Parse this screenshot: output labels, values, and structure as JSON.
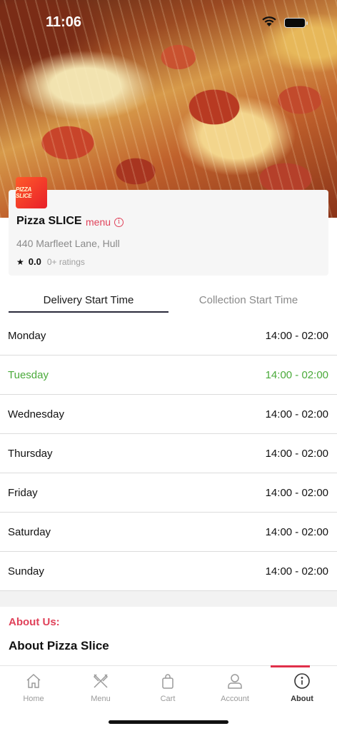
{
  "status_bar": {
    "time": "11:06"
  },
  "restaurant": {
    "logo_text": "PIZZA SLICE",
    "name": "Pizza SLICE",
    "menu_link": "menu",
    "address": "440 Marfleet Lane, Hull",
    "rating": "0.0",
    "ratings_count": "0+ ratings"
  },
  "tabs": [
    {
      "label": "Delivery Start Time",
      "active": true
    },
    {
      "label": "Collection Start Time",
      "active": false
    }
  ],
  "schedule": [
    {
      "day": "Monday",
      "hours": "14:00 - 02:00",
      "today": false
    },
    {
      "day": "Tuesday",
      "hours": "14:00 - 02:00",
      "today": true
    },
    {
      "day": "Wednesday",
      "hours": "14:00 - 02:00",
      "today": false
    },
    {
      "day": "Thursday",
      "hours": "14:00 - 02:00",
      "today": false
    },
    {
      "day": "Friday",
      "hours": "14:00 - 02:00",
      "today": false
    },
    {
      "day": "Saturday",
      "hours": "14:00 - 02:00",
      "today": false
    },
    {
      "day": "Sunday",
      "hours": "14:00 - 02:00",
      "today": false
    }
  ],
  "about": {
    "section_label": "About Us:",
    "title": "About Pizza Slice"
  },
  "bottom_nav": [
    {
      "label": "Home",
      "icon": "home-icon",
      "active": false
    },
    {
      "label": "Menu",
      "icon": "fork-knife-icon",
      "active": false
    },
    {
      "label": "Cart",
      "icon": "shopping-bag-icon",
      "active": false
    },
    {
      "label": "Account",
      "icon": "user-icon",
      "active": false
    },
    {
      "label": "About",
      "icon": "info-icon",
      "active": true
    }
  ],
  "colors": {
    "accent": "#e0425a",
    "today": "#4aaa3a",
    "active_tab_underline": "#2a2a3a",
    "nav_active_bar": "#e0304a"
  }
}
